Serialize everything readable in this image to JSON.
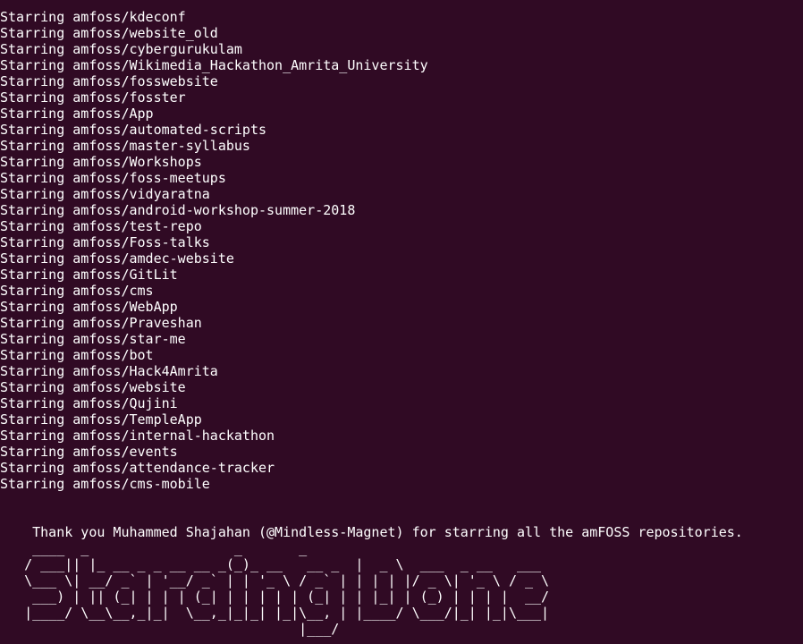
{
  "terminal": {
    "background_color": "#300a24",
    "text_color": "#ffffff",
    "lines": [
      "Starring amfoss/kdeconf",
      "Starring amfoss/website_old",
      "Starring amfoss/cybergurukulam",
      "Starring amfoss/Wikimedia_Hackathon_Amrita_University",
      "Starring amfoss/fosswebsite",
      "Starring amfoss/fosster",
      "Starring amfoss/App",
      "Starring amfoss/automated-scripts",
      "Starring amfoss/master-syllabus",
      "Starring amfoss/Workshops",
      "Starring amfoss/foss-meetups",
      "Starring amfoss/vidyaratna",
      "Starring amfoss/android-workshop-summer-2018",
      "Starring amfoss/test-repo",
      "Starring amfoss/Foss-talks",
      "Starring amfoss/amdec-website",
      "Starring amfoss/GitLit",
      "Starring amfoss/cms",
      "Starring amfoss/WebApp",
      "Starring amfoss/Praveshan",
      "Starring amfoss/star-me",
      "Starring amfoss/bot",
      "Starring amfoss/Hack4Amrita",
      "Starring amfoss/website",
      "Starring amfoss/Qujini",
      "Starring amfoss/TempleApp",
      "Starring amfoss/internal-hackathon",
      "Starring amfoss/events",
      "Starring amfoss/attendance-tracker",
      "Starring amfoss/cms-mobile"
    ],
    "thanks_message": "    Thank you Muhammed Shajahan (@Mindless-Magnet) for starring all the amFOSS repositories.",
    "banner_art": "    ____  _                  _       _                           \n   / ___|| |_ __ _ _ __ __ _(_)_ __   __ _  |  _ \\  ___  _ __   ___ \n   \\___ \\| __/ _` | '__/ _` | | '_ \\ / _` | | | | |/ _ \\| '_ \\ / _ \\\n    ___) | || (_| | | | (_| | | | | | (_| | | |_| | (_) | | | |  __/\n   |____/ \\__\\__,_|_|  \\__,_|_|_| |_|\\__, | |____/ \\___/|_| |_|\\___|\n                                     |___/                          ",
    "banner_text": "Starring Done"
  }
}
